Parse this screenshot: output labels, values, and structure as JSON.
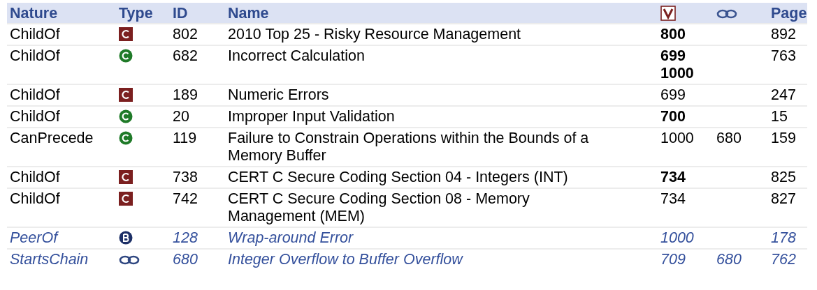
{
  "table": {
    "columns": [
      {
        "kind": "text",
        "label": "Nature"
      },
      {
        "kind": "text",
        "label": "Type"
      },
      {
        "kind": "text",
        "label": "ID"
      },
      {
        "kind": "text",
        "label": "Name"
      },
      {
        "kind": "view"
      },
      {
        "kind": "chain"
      },
      {
        "kind": "text",
        "label": "Page"
      }
    ],
    "rows": [
      {
        "nature": "ChildOf",
        "kind": "category",
        "id": "802",
        "name": "2010 Top 25 - Risky Resource Management",
        "views": [
          {
            "text": "800",
            "bold": true
          }
        ],
        "chain": "",
        "page": "892",
        "italic": false
      },
      {
        "nature": "ChildOf",
        "kind": "weakness",
        "id": "682",
        "name": "Incorrect Calculation",
        "views": [
          {
            "text": "699",
            "bold": true
          },
          {
            "text": "1000",
            "bold": true
          }
        ],
        "chain": "",
        "page": "763",
        "italic": false
      },
      {
        "nature": "ChildOf",
        "kind": "category",
        "id": "189",
        "name": "Numeric Errors",
        "views": [
          {
            "text": "699",
            "bold": false
          }
        ],
        "chain": "",
        "page": "247",
        "italic": false
      },
      {
        "nature": "ChildOf",
        "kind": "weakness",
        "id": "20",
        "name": "Improper Input Validation",
        "views": [
          {
            "text": "700",
            "bold": true
          }
        ],
        "chain": "",
        "page": "15",
        "italic": false
      },
      {
        "nature": "CanPrecede",
        "kind": "weakness",
        "id": "119",
        "name": "Failure to Constrain Operations within the Bounds of a Memory Buffer",
        "views": [
          {
            "text": "1000",
            "bold": false
          }
        ],
        "chain": "680",
        "page": "159",
        "italic": false
      },
      {
        "nature": "ChildOf",
        "kind": "category",
        "id": "738",
        "name": "CERT C Secure Coding Section 04 - Integers (INT)",
        "views": [
          {
            "text": "734",
            "bold": true
          }
        ],
        "chain": "",
        "page": "825",
        "italic": false
      },
      {
        "nature": "ChildOf",
        "kind": "category",
        "id": "742",
        "name": "CERT C Secure Coding Section 08 - Memory Management (MEM)",
        "views": [
          {
            "text": "734",
            "bold": false
          }
        ],
        "chain": "",
        "page": "827",
        "italic": false
      },
      {
        "nature": "PeerOf",
        "kind": "base",
        "id": "128",
        "name": "Wrap-around Error",
        "views": [
          {
            "text": "1000",
            "bold": false
          }
        ],
        "chain": "",
        "page": "178",
        "italic": true
      },
      {
        "nature": "StartsChain",
        "kind": "chain",
        "id": "680",
        "name": "Integer Overflow to Buffer Overflow",
        "views": [
          {
            "text": "709",
            "bold": false
          }
        ],
        "chain": "680",
        "page": "762",
        "italic": true
      }
    ]
  }
}
